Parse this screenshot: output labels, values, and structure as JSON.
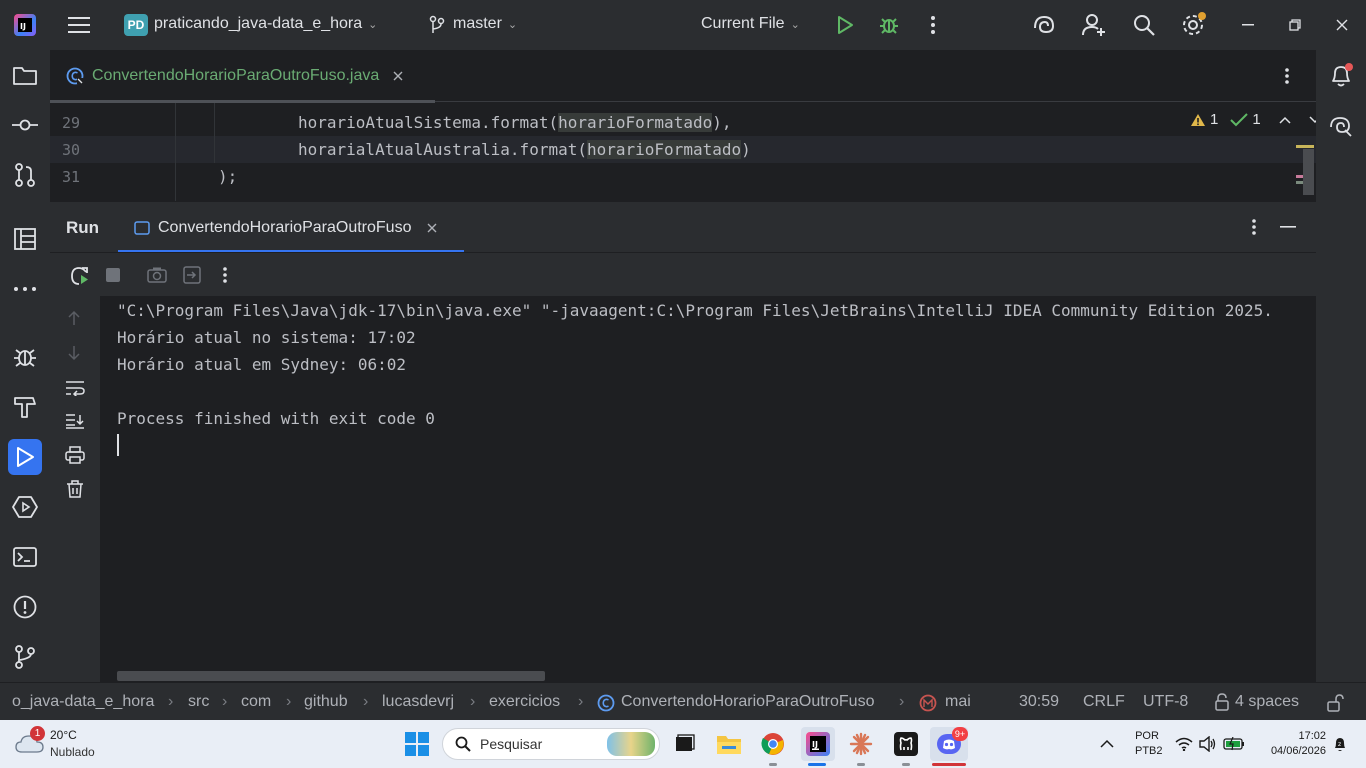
{
  "titlebar": {
    "project_initials": "PD",
    "project_name": "praticando_java-data_e_hora",
    "branch": "master",
    "run_config": "Current File"
  },
  "editor": {
    "tab_file": "ConvertendoHorarioParaOutroFuso.java",
    "inspections": {
      "warnings": "1",
      "ok": "1"
    },
    "lines": [
      {
        "number": "29",
        "before": "horarioAtualSistema.format(",
        "highlight": "horarioFormatado",
        "after": "),"
      },
      {
        "number": "30",
        "before": "horarialAtualAustralia.format(",
        "highlight": "horarioFormatado",
        "after": ")"
      },
      {
        "number": "31",
        "text": ");"
      }
    ]
  },
  "run": {
    "title": "Run",
    "tab_label": "ConvertendoHorarioParaOutroFuso",
    "output": [
      "\"C:\\Program Files\\Java\\jdk-17\\bin\\java.exe\" \"-javaagent:C:\\Program Files\\JetBrains\\IntelliJ IDEA Community Edition 2025.",
      "Horário atual no sistema: 17:02",
      "Horário atual em Sydney: 06:02",
      "",
      "Process finished with exit code 0"
    ]
  },
  "statusbar": {
    "breadcrumbs": [
      "o_java-data_e_hora",
      "src",
      "com",
      "github",
      "lucasdevrj",
      "exercicios",
      "ConvertendoHorarioParaOutroFuso",
      "mai"
    ],
    "position": "30:59",
    "line_sep": "CRLF",
    "encoding": "UTF-8",
    "indent": "4 spaces"
  },
  "taskbar": {
    "weather_temp": "20°C",
    "weather_desc": "Nublado",
    "weather_badge": "1",
    "search_placeholder": "Pesquisar",
    "lang_top": "POR",
    "lang_bottom": "PTB2",
    "time": "17:02",
    "date": "04/06/2026",
    "discord_badge": "9+"
  },
  "colors": {
    "accent": "#3574f0",
    "file_tab_text": "#6aab73",
    "warning": "#e0b74a",
    "ok": "#5fb865"
  }
}
